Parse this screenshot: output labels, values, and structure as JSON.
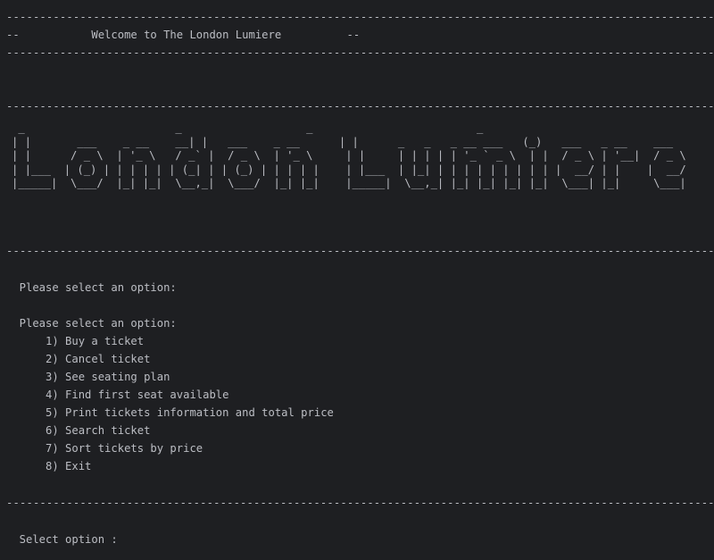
{
  "separator": "------------------------------------------------------------------------------------------------------------------------------------------------",
  "welcome_line": "--           Welcome to The London Lumiere          --",
  "banner": " _                       _                   _                         _                         \n| |       ___    _ __    __| |   ___    _ __      | |      _   _   _ __ ___   (_)   ___   _ __    ___ \n| |      / _ \\  | '_ \\   / _` |  / _ \\  | '_ \\     | |     | | | | | '_ ` _ \\  | |  / _ \\ | '__|  / _ \\\n| |___  | (_) | | | | | | (_| | | (_) | | | | |    | |___  | |_| | | | | | | | | | |  __/ | |    |  __/\n|_____|  \\___/  |_| |_|  \\__,_|  \\___/  |_| |_|    |_____|  \\__,_| |_| |_| |_| |_|  \\___| |_|     \\___|",
  "prompt_first": "  Please select an option:",
  "prompt_second": "  Please select an option:",
  "menu": {
    "items": [
      "      1) Buy a ticket",
      "      2) Cancel ticket",
      "      3) See seating plan",
      "      4) Find first seat available",
      "      5) Print tickets information and total price",
      "      6) Search ticket",
      "      7) Sort tickets by price",
      "      8) Exit"
    ]
  },
  "select_option": "  Select option :"
}
